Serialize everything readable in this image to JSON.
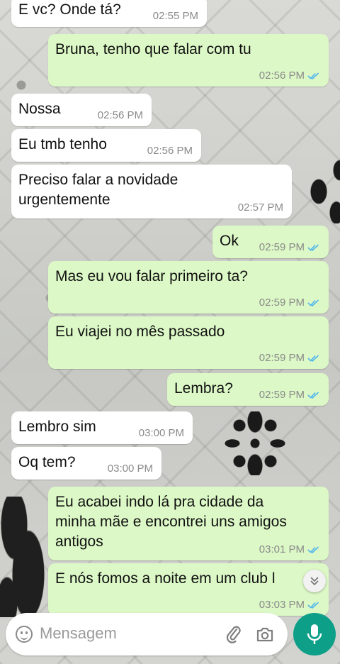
{
  "messages": [
    {
      "dir": "in",
      "text": "E vc? Onde tá?",
      "time": "02:55 PM"
    },
    {
      "dir": "out",
      "text": "Bruna, tenho que falar com tu",
      "time": "02:56 PM"
    },
    {
      "dir": "in",
      "text": "Nossa",
      "time": "02:56 PM"
    },
    {
      "dir": "in",
      "text": "Eu tmb tenho",
      "time": "02:56 PM"
    },
    {
      "dir": "in",
      "text": "Preciso falar a novidade\nurgentemente",
      "time": "02:57 PM"
    },
    {
      "dir": "out",
      "text": "Ok",
      "time": "02:59 PM"
    },
    {
      "dir": "out",
      "text": "Mas eu vou falar primeiro ta?",
      "time": "02:59 PM"
    },
    {
      "dir": "out",
      "text": "Eu viajei no mês passado",
      "time": "02:59 PM"
    },
    {
      "dir": "out",
      "text": "Lembra?",
      "time": "02:59 PM"
    },
    {
      "dir": "in",
      "text": "Lembro sim",
      "time": "03:00 PM"
    },
    {
      "dir": "in",
      "text": "Oq tem?",
      "time": "03:00 PM"
    },
    {
      "dir": "out",
      "text": "Eu acabei indo lá pra cidade da\nminha mãe e encontrei uns amigos\nantigos",
      "time": "03:01 PM"
    },
    {
      "dir": "out",
      "text": "E nós fomos a noite em um club l",
      "time": "03:03 PM"
    }
  ],
  "input": {
    "placeholder": "Mensagem"
  },
  "icons": {
    "emoji": "emoji-icon",
    "attach": "paperclip-icon",
    "camera": "camera-icon",
    "mic": "microphone-icon",
    "scroll": "chevron-double-down-icon",
    "read": "double-check-icon"
  },
  "colors": {
    "outgoing": "#dcf8c6",
    "incoming": "#ffffff",
    "accent": "#0e9f89",
    "read_ticks": "#4fb6ec"
  }
}
